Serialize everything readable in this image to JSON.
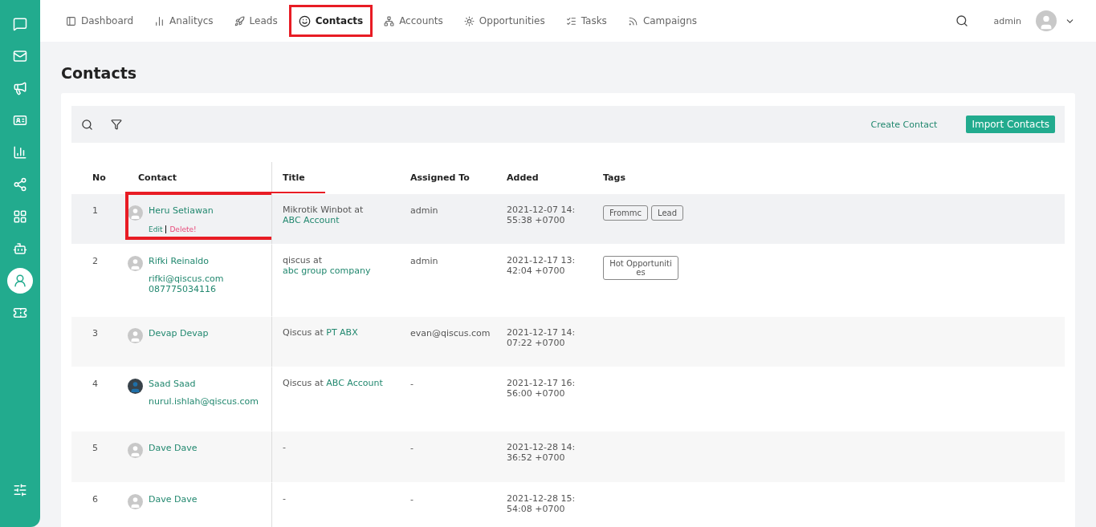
{
  "sidebar": {
    "items": [
      {
        "selected": false
      },
      {
        "selected": false
      },
      {
        "selected": false
      },
      {
        "selected": false
      },
      {
        "selected": false
      },
      {
        "selected": false
      },
      {
        "selected": false
      },
      {
        "selected": false
      },
      {
        "selected": true
      },
      {
        "selected": false
      }
    ]
  },
  "nav": {
    "items": [
      {
        "label": "Dashboard",
        "selected": false,
        "highlighted": false
      },
      {
        "label": "Analitycs",
        "selected": false,
        "highlighted": false
      },
      {
        "label": "Leads",
        "selected": false,
        "highlighted": false
      },
      {
        "label": "Contacts",
        "selected": true,
        "highlighted": true
      },
      {
        "label": "Accounts",
        "selected": false,
        "highlighted": false
      },
      {
        "label": "Opportunities",
        "selected": false,
        "highlighted": false
      },
      {
        "label": "Tasks",
        "selected": false,
        "highlighted": false
      },
      {
        "label": "Campaigns",
        "selected": false,
        "highlighted": false
      }
    ],
    "user": "admin"
  },
  "page_title": "Contacts",
  "toolbar": {
    "create": "Create Contact",
    "import": "Import Contacts"
  },
  "table": {
    "columns": [
      "No",
      "Contact",
      "Title",
      "Assigned To",
      "Added",
      "Tags"
    ],
    "rows": [
      {
        "no": "1",
        "name": "Heru Setiawan",
        "kind": "default",
        "details": [],
        "actions": {
          "edit": "Edit",
          "delete": "Delete!"
        },
        "highlighted": true,
        "title": {
          "name": "Mikrotik Winbot",
          "at": "at",
          "account": "ABC Account"
        },
        "assigned": "admin",
        "added": "2021-12-07 14:55:38 +0700",
        "tags": [
          "Frommc",
          "Lead"
        ]
      },
      {
        "no": "2",
        "name": "Rifki Reinaldo",
        "kind": "default",
        "details": [
          "rifki@qiscus.com",
          "087775034116"
        ],
        "highlighted": false,
        "title": {
          "name": "qiscus",
          "at": "at",
          "account": "abc group company"
        },
        "assigned": "admin",
        "added": "2021-12-17 13:42:04 +0700",
        "tags": [
          "Hot Opportunities"
        ]
      },
      {
        "no": "3",
        "name": "Devap Devap",
        "kind": "default",
        "details": [],
        "highlighted": false,
        "title": {
          "name": "Qiscus",
          "at": "at",
          "account": "PT ABX"
        },
        "assigned": "evan@qiscus.com",
        "added": "2021-12-17 14:07:22 +0700",
        "tags": []
      },
      {
        "no": "4",
        "name": "Saad Saad",
        "kind": "photo",
        "details": [
          "nurul.ishlah@qiscus.com"
        ],
        "highlighted": false,
        "title": {
          "name": "Qiscus",
          "at": "at",
          "account": "ABC Account"
        },
        "assigned": "-",
        "added": "2021-12-17 16:56:00 +0700",
        "tags": []
      },
      {
        "no": "5",
        "name": "Dave Dave",
        "kind": "default",
        "details": [],
        "highlighted": false,
        "title": {
          "name": "-"
        },
        "assigned": "-",
        "added": "2021-12-28 14:36:52 +0700",
        "tags": []
      },
      {
        "no": "6",
        "name": "Dave Dave",
        "kind": "default",
        "details": [],
        "highlighted": false,
        "title": {
          "name": "-"
        },
        "assigned": "-",
        "added": "2021-12-28 15:54:08 +0700",
        "tags": []
      }
    ]
  }
}
